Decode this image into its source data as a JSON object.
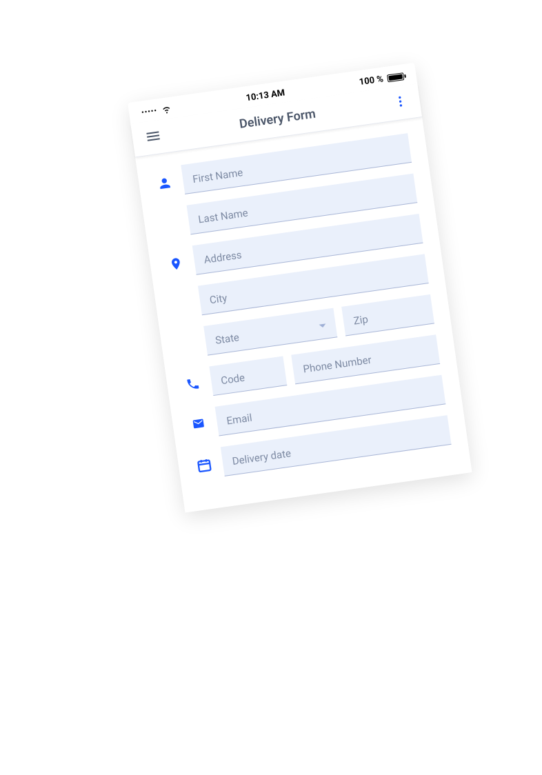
{
  "statusbar": {
    "time": "10:13 AM",
    "battery_text": "100 %",
    "signal_dots": "•••••"
  },
  "appbar": {
    "title": "Delivery Form"
  },
  "fields": {
    "first_name": {
      "placeholder": "First Name"
    },
    "last_name": {
      "placeholder": "Last Name"
    },
    "address": {
      "placeholder": "Address"
    },
    "city": {
      "placeholder": "City"
    },
    "state": {
      "placeholder": "State"
    },
    "zip": {
      "placeholder": "Zip"
    },
    "code": {
      "placeholder": "Code"
    },
    "phone": {
      "placeholder": "Phone Number"
    },
    "email": {
      "placeholder": "Email"
    },
    "delivery_date": {
      "placeholder": "Delivery date"
    }
  }
}
